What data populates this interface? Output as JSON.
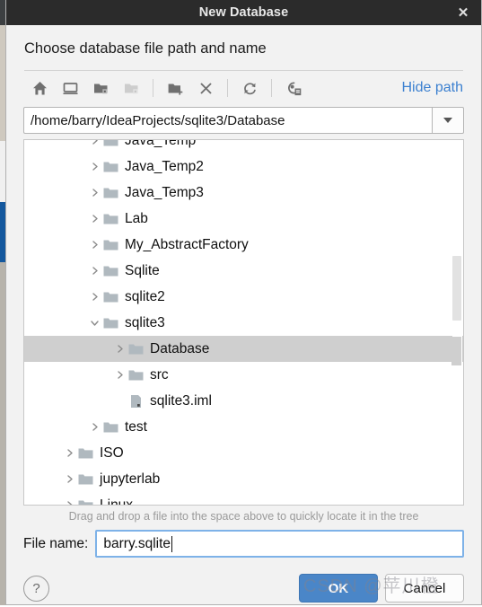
{
  "window": {
    "title": "New Database",
    "close_icon": "close-icon"
  },
  "header": {
    "prompt": "Choose database file path and name"
  },
  "toolbar": {
    "buttons": [
      {
        "name": "home-icon",
        "label": "Home",
        "enabled": true
      },
      {
        "name": "desktop-icon",
        "label": "Desktop",
        "enabled": true
      },
      {
        "name": "folder-up-icon",
        "label": "Up",
        "enabled": true
      },
      {
        "name": "folder-back-icon",
        "label": "Back",
        "enabled": false
      },
      {
        "name": "new-folder-icon",
        "label": "New Folder",
        "enabled": true
      },
      {
        "name": "delete-icon",
        "label": "Delete",
        "enabled": true
      },
      {
        "name": "refresh-icon",
        "label": "Refresh",
        "enabled": true
      },
      {
        "name": "show-hidden-icon",
        "label": "Show Hidden Files",
        "enabled": true
      }
    ],
    "hide_path_label": "Hide path"
  },
  "path": {
    "value": "/home/barry/IdeaProjects/sqlite3/Database",
    "dropdown_icon": "chevron-down-icon"
  },
  "tree": {
    "items": [
      {
        "label": "Java_Temp",
        "depth": 2,
        "type": "folder",
        "state": "collapsed",
        "selected": false
      },
      {
        "label": "Java_Temp2",
        "depth": 2,
        "type": "folder",
        "state": "collapsed",
        "selected": false
      },
      {
        "label": "Java_Temp3",
        "depth": 2,
        "type": "folder",
        "state": "collapsed",
        "selected": false
      },
      {
        "label": "Lab",
        "depth": 2,
        "type": "folder",
        "state": "collapsed",
        "selected": false
      },
      {
        "label": "My_AbstractFactory",
        "depth": 2,
        "type": "folder",
        "state": "collapsed",
        "selected": false
      },
      {
        "label": "Sqlite",
        "depth": 2,
        "type": "folder",
        "state": "collapsed",
        "selected": false
      },
      {
        "label": "sqlite2",
        "depth": 2,
        "type": "folder",
        "state": "collapsed",
        "selected": false
      },
      {
        "label": "sqlite3",
        "depth": 2,
        "type": "folder",
        "state": "expanded",
        "selected": false
      },
      {
        "label": "Database",
        "depth": 3,
        "type": "folder",
        "state": "collapsed",
        "selected": true
      },
      {
        "label": "src",
        "depth": 3,
        "type": "folder",
        "state": "collapsed",
        "selected": false
      },
      {
        "label": "sqlite3.iml",
        "depth": 3,
        "type": "file",
        "state": "none",
        "selected": false
      },
      {
        "label": "test",
        "depth": 2,
        "type": "folder",
        "state": "collapsed",
        "selected": false
      },
      {
        "label": "ISO",
        "depth": 1,
        "type": "folder",
        "state": "collapsed",
        "selected": false
      },
      {
        "label": "jupyterlab",
        "depth": 1,
        "type": "folder",
        "state": "collapsed",
        "selected": false
      },
      {
        "label": "Linux",
        "depth": 1,
        "type": "folder",
        "state": "collapsed",
        "selected": false
      }
    ],
    "hint": "Drag and drop a file into the space above to quickly locate it in the tree"
  },
  "file_name": {
    "label": "File name:",
    "value": "barry.sqlite",
    "placeholder": ""
  },
  "actions": {
    "help_label": "?",
    "ok_label": "OK",
    "cancel_label": "Cancel"
  },
  "watermark": {
    "text": "CSDN @苹川橙"
  },
  "colors": {
    "titlebar_bg": "#2b2b2b",
    "dialog_bg": "#f2f2f2",
    "link_blue": "#3c80d0",
    "ok_blue": "#4a86c8",
    "focus_border": "#7eb2e8",
    "selection_grey": "#cfcfcf",
    "folder_grey": "#b0b9bf"
  }
}
